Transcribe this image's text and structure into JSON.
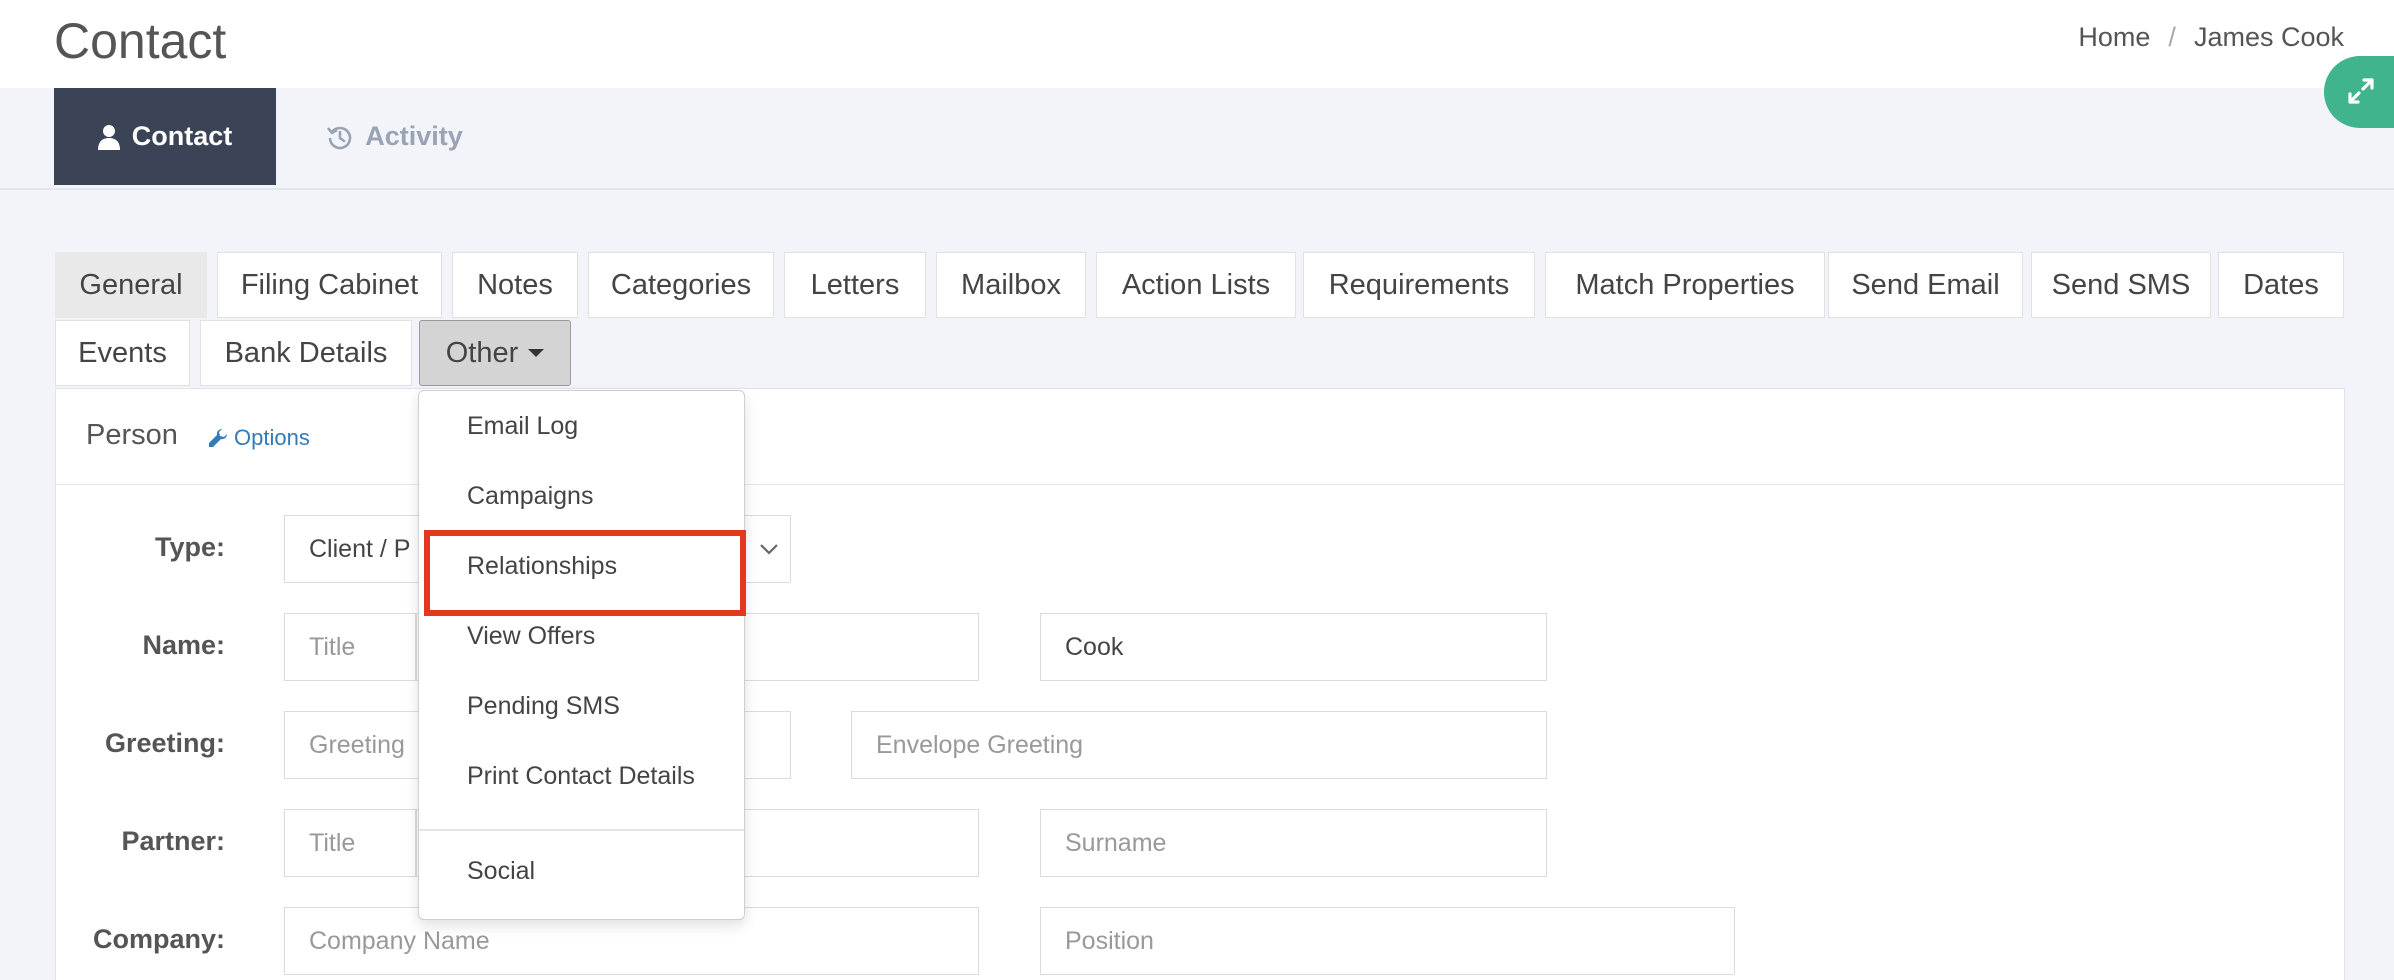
{
  "header": {
    "title": "Contact",
    "breadcrumb": {
      "home": "Home",
      "separator": "/",
      "current": "James Cook"
    }
  },
  "main_tabs": [
    {
      "label": "Contact",
      "icon": "user-icon",
      "active": true
    },
    {
      "label": "Activity",
      "icon": "history-icon",
      "active": false
    }
  ],
  "subtabs": {
    "general": "General",
    "filing_cabinet": "Filing Cabinet",
    "notes": "Notes",
    "categories": "Categories",
    "letters": "Letters",
    "mailbox": "Mailbox",
    "action_lists": "Action Lists",
    "requirements": "Requirements",
    "match_properties": "Match Properties",
    "send_email": "Send Email",
    "send_sms": "Send SMS",
    "dates": "Dates",
    "events": "Events",
    "bank_details": "Bank Details",
    "other": "Other"
  },
  "dropdown": {
    "items": [
      "Email Log",
      "Campaigns",
      "Relationships",
      "View Offers",
      "Pending SMS",
      "Print Contact Details",
      "Social"
    ],
    "highlighted": "Relationships"
  },
  "panel": {
    "title": "Person",
    "options_label": "Options",
    "options_icon": "wrench-icon"
  },
  "form": {
    "type_label": "Type:",
    "type_value": "Client / P",
    "name_label": "Name:",
    "name_title_placeholder": "Title",
    "name_surname_value": "Cook",
    "greeting_label": "Greeting:",
    "greeting_placeholder": "Greeting",
    "envelope_greeting_placeholder": "Envelope Greeting",
    "partner_label": "Partner:",
    "partner_title_placeholder": "Title",
    "partner_surname_placeholder": "Surname",
    "company_label": "Company:",
    "company_name_placeholder": "Company Name",
    "position_placeholder": "Position"
  },
  "colors": {
    "active_tab_bg": "#3b4457",
    "fab_green": "#3fb48d",
    "highlight_red": "#e4371f",
    "link_blue": "#337ab7"
  }
}
